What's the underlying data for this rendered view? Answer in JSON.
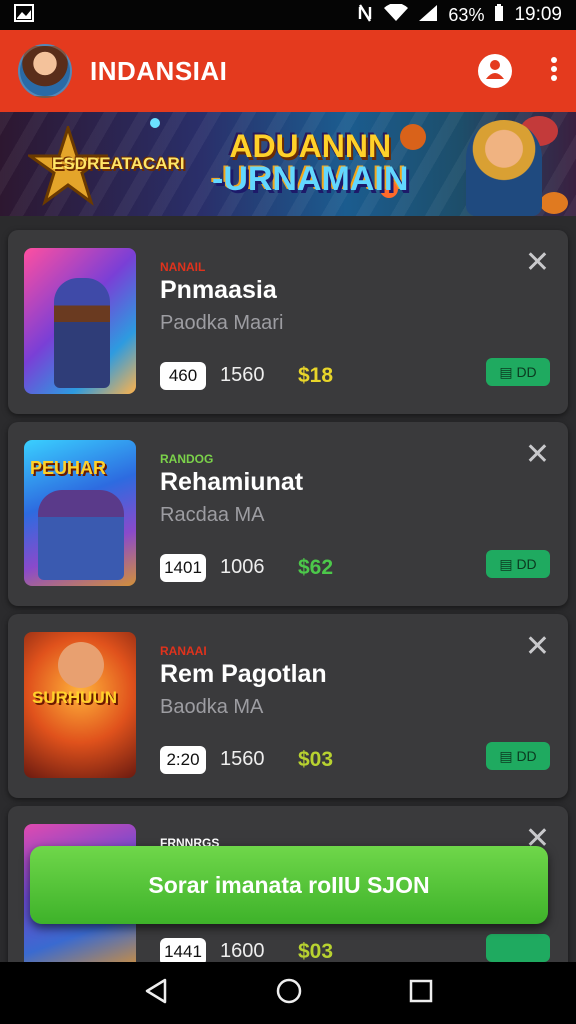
{
  "status_bar": {
    "battery": "63%",
    "time": "19:09"
  },
  "app_bar": {
    "title": "INDANSIAI"
  },
  "banner": {
    "brand_text": "ESDREATACARI",
    "headline_line1": "ADUANNN",
    "headline_line2": "-URNAMAIN"
  },
  "cards": [
    {
      "thumb_label": "",
      "tag": "NANAIL",
      "tag_color": "#e0321c",
      "title": "Pnmaasia",
      "subtitle": "Paodka Maari",
      "pill": "460",
      "count": "1560",
      "price": "$18",
      "price_color": "#e8d52a",
      "play_label": "▤ DD"
    },
    {
      "thumb_label": "PEUHAR",
      "tag": "RANDOG",
      "tag_color": "#7bd24a",
      "title": "Rehamiunat",
      "subtitle": "Racdaa MA",
      "pill": "1401",
      "count": "1006",
      "price": "$62",
      "price_color": "#4cc84a",
      "play_label": "▤ DD"
    },
    {
      "thumb_label": "SURHUUN",
      "tag": "RANAAI",
      "tag_color": "#e0321c",
      "title": "Rem Pagotlan",
      "subtitle": "Baodka MA",
      "pill": "2:20",
      "count": "1560",
      "price": "$03",
      "price_color": "#b8d230",
      "play_label": "▤ DD"
    },
    {
      "thumb_label": "",
      "tag": "FRNNRGS",
      "tag_color": "#ffffff",
      "title": "",
      "subtitle": "",
      "pill": "1441",
      "count": "1600",
      "price": "$03",
      "price_color": "#b8d230",
      "play_label": ""
    }
  ],
  "cta": {
    "label": "Sorar imanata roIIU SJON"
  },
  "colors": {
    "app_bar": "#e43a1e",
    "card_bg": "#3a3a3c",
    "cta": "#4cc038",
    "play_button": "#1faa60"
  }
}
